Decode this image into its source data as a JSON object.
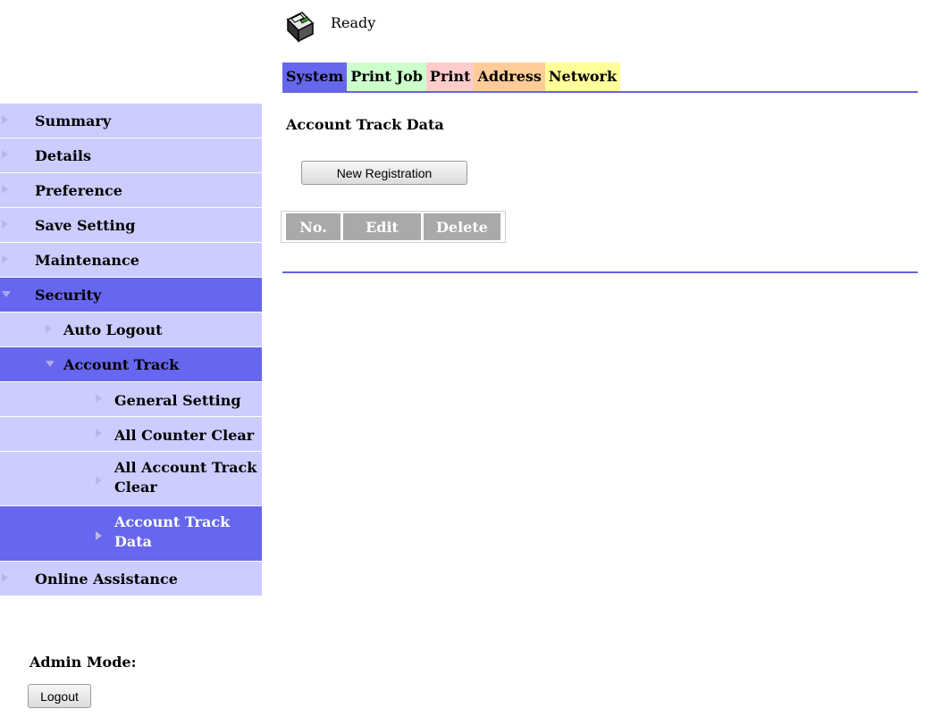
{
  "status": {
    "text": "Ready",
    "icon": "printer-icon"
  },
  "tabs": [
    {
      "label": "System",
      "color": "#6666ee",
      "active": true
    },
    {
      "label": "Print Job",
      "color": "#ccffcc"
    },
    {
      "label": "Print",
      "color": "#ffcccc"
    },
    {
      "label": "Address",
      "color": "#ffcc99"
    },
    {
      "label": "Network",
      "color": "#ffff99"
    }
  ],
  "sidebar": {
    "items": [
      {
        "label": "Summary"
      },
      {
        "label": "Details"
      },
      {
        "label": "Preference"
      },
      {
        "label": "Save Setting"
      },
      {
        "label": "Maintenance"
      },
      {
        "label": "Security",
        "expanded": true
      },
      {
        "label": "Auto Logout"
      },
      {
        "label": "Account Track",
        "expanded": true
      },
      {
        "label": "General Setting"
      },
      {
        "label": "All Counter Clear"
      },
      {
        "label": "All Account Track Clear"
      },
      {
        "label": "Account Track Data",
        "selected": true
      },
      {
        "label": "Online Assistance"
      }
    ]
  },
  "main": {
    "title": "Account Track Data",
    "new_registration_label": "New Registration",
    "table_headers": [
      "No.",
      "Edit",
      "Delete"
    ]
  },
  "footer": {
    "admin_label": "Admin Mode:",
    "logout_label": "Logout"
  },
  "colors": {
    "nav_bg": "#ccccff",
    "nav_active_bg": "#6666ee",
    "divider": "#6666dd",
    "table_header_bg": "#a9a9a9"
  }
}
